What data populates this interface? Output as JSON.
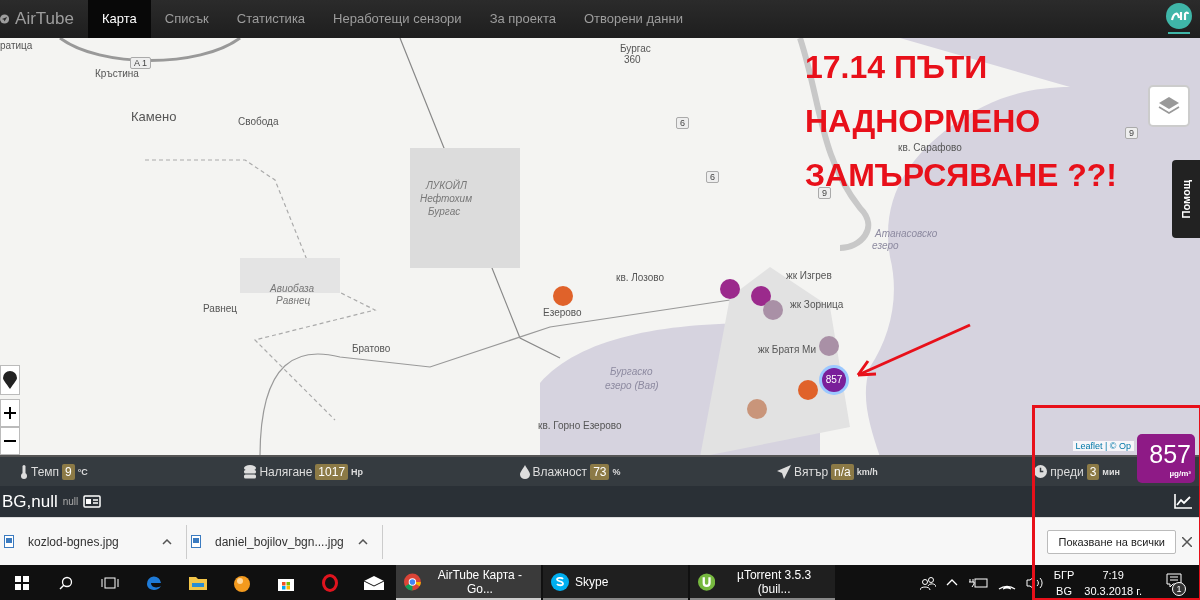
{
  "nav": {
    "brand": "AirTube",
    "tabs": [
      {
        "label": "Карта",
        "selected": true
      },
      {
        "label": "Списък",
        "selected": false
      },
      {
        "label": "Статистика",
        "selected": false
      },
      {
        "label": "Неработещи сензори",
        "selected": false
      },
      {
        "label": "За проекта",
        "selected": false
      },
      {
        "label": "Отворени данни",
        "selected": false
      }
    ]
  },
  "map": {
    "labels": [
      {
        "text": "ратица",
        "kind": "place"
      },
      {
        "text": "Кръстина",
        "kind": "place"
      },
      {
        "text": "Камено",
        "kind": "town"
      },
      {
        "text": "Свобода",
        "kind": "place"
      },
      {
        "text": "ЛУКОЙЛ",
        "kind": "area"
      },
      {
        "text": "Нефтохим",
        "kind": "area"
      },
      {
        "text": "Бургас",
        "kind": "area"
      },
      {
        "text": "Авиобаза",
        "kind": "area"
      },
      {
        "text": "Равнец",
        "kind": "area"
      },
      {
        "text": "Равнец",
        "kind": "place"
      },
      {
        "text": "Братово",
        "kind": "place"
      },
      {
        "text": "Езерово",
        "kind": "place"
      },
      {
        "text": "кв. Лозово",
        "kind": "place"
      },
      {
        "text": "жк Изгрев",
        "kind": "place"
      },
      {
        "text": "жк Зорница",
        "kind": "place"
      },
      {
        "text": "жк Братя Ми",
        "kind": "place"
      },
      {
        "text": "Бургаско",
        "kind": "water"
      },
      {
        "text": "езеро (Вая)",
        "kind": "water"
      },
      {
        "text": "кв. Горно Езерово",
        "kind": "place"
      },
      {
        "text": "кв. Сарафово",
        "kind": "place"
      },
      {
        "text": "Атанасовско",
        "kind": "water"
      },
      {
        "text": "езеро",
        "kind": "water"
      },
      {
        "text": "Бургас",
        "kind": "road"
      },
      {
        "text": "360",
        "kind": "road"
      }
    ],
    "road_signs": [
      "A 1",
      "6",
      "6",
      "9",
      "9"
    ],
    "markers": [
      {
        "color": "#e0622a"
      },
      {
        "color": "#9b2a8c"
      },
      {
        "color": "#9b2a8c"
      },
      {
        "color": "#a990a6"
      },
      {
        "color": "#a990a6"
      },
      {
        "color": "#e0622a"
      },
      {
        "color": "#c9957a"
      }
    ],
    "cluster": {
      "label": "857",
      "color": "#7a1f9a"
    },
    "attribution": "Leaflet | © Op",
    "help_tab": "Помощ",
    "annotation": [
      "17.14 ПЪТИ",
      "НАДНОРМЕНО",
      "ЗАМЪРСЯВАНЕ ??!"
    ]
  },
  "reading": {
    "value": "857",
    "unit": "µg/m³",
    "color": "#8e1a86"
  },
  "sensor_bar": [
    {
      "kind": "temp",
      "label": "Темп",
      "value": "9",
      "unit": "°C"
    },
    {
      "kind": "pressure",
      "label": "Налягане",
      "value": "1017",
      "unit": "Hp"
    },
    {
      "kind": "humidity",
      "label": "Влажност",
      "value": "73",
      "unit": "%"
    },
    {
      "kind": "wind",
      "label": "Вятър",
      "value": "n/a",
      "unit": "km/h"
    },
    {
      "kind": "time",
      "label": "преди",
      "value": "3",
      "unit": "мин"
    }
  ],
  "station": {
    "name": "BG,null",
    "sub": "null"
  },
  "downloads": {
    "files": [
      "kozlod-bgnes.jpg",
      "daniel_bojilov_bgn....jpg"
    ],
    "show_all": "Показване на всички"
  },
  "taskbar": {
    "tasks": [
      {
        "kind": "chrome",
        "label": "AirTube Карта - Go...",
        "selected": true
      },
      {
        "kind": "skype",
        "label": "Skype",
        "selected": false
      },
      {
        "kind": "torrent",
        "label": "µTorrent 3.5.3  (buil...",
        "selected": false
      }
    ],
    "lang": [
      "БГР",
      "BG"
    ],
    "time": "7:19",
    "date": "30.3.2018 г.",
    "notifications": "1"
  }
}
